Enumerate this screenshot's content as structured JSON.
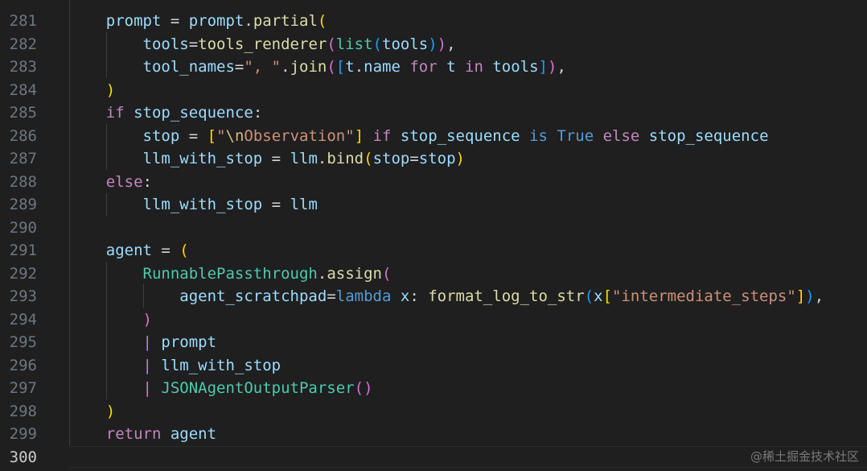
{
  "editor": {
    "current_line": 300,
    "lines": [
      {
        "no": "281",
        "tokens": [
          [
            "    ",
            "op"
          ],
          [
            "prompt",
            "var"
          ],
          [
            " = ",
            "op"
          ],
          [
            "prompt",
            "var"
          ],
          [
            ".",
            "op"
          ],
          [
            "partial",
            "fn"
          ],
          [
            "(",
            "p1"
          ]
        ]
      },
      {
        "no": "282",
        "tokens": [
          [
            "        ",
            "op"
          ],
          [
            "tools",
            "var"
          ],
          [
            "=",
            "op"
          ],
          [
            "tools_renderer",
            "fn"
          ],
          [
            "(",
            "p2"
          ],
          [
            "list",
            "cls"
          ],
          [
            "(",
            "p3"
          ],
          [
            "tools",
            "var"
          ],
          [
            ")",
            "p3"
          ],
          [
            ")",
            "p2"
          ],
          [
            ",",
            "op"
          ]
        ]
      },
      {
        "no": "283",
        "tokens": [
          [
            "        ",
            "op"
          ],
          [
            "tool_names",
            "var"
          ],
          [
            "=",
            "op"
          ],
          [
            "\", \"",
            "str"
          ],
          [
            ".",
            "op"
          ],
          [
            "join",
            "fn"
          ],
          [
            "(",
            "p2"
          ],
          [
            "[",
            "p3"
          ],
          [
            "t",
            "var"
          ],
          [
            ".",
            "op"
          ],
          [
            "name",
            "var"
          ],
          [
            " for ",
            "kw"
          ],
          [
            "t",
            "var"
          ],
          [
            " in ",
            "kw"
          ],
          [
            "tools",
            "var"
          ],
          [
            "]",
            "p3"
          ],
          [
            ")",
            "p2"
          ],
          [
            ",",
            "op"
          ]
        ]
      },
      {
        "no": "284",
        "tokens": [
          [
            "    ",
            "op"
          ],
          [
            ")",
            "p1"
          ]
        ]
      },
      {
        "no": "285",
        "tokens": [
          [
            "    ",
            "op"
          ],
          [
            "if",
            "kw"
          ],
          [
            " ",
            "op"
          ],
          [
            "stop_sequence",
            "var"
          ],
          [
            ":",
            "op"
          ]
        ]
      },
      {
        "no": "286",
        "tokens": [
          [
            "        ",
            "op"
          ],
          [
            "stop",
            "var"
          ],
          [
            " = ",
            "op"
          ],
          [
            "[",
            "p1"
          ],
          [
            "\"",
            "str"
          ],
          [
            "\\n",
            "esc"
          ],
          [
            "Observation\"",
            "str"
          ],
          [
            "]",
            "p1"
          ],
          [
            " if ",
            "kw"
          ],
          [
            "stop_sequence",
            "var"
          ],
          [
            " is ",
            "kw2"
          ],
          [
            "True",
            "kw2"
          ],
          [
            " else ",
            "kw"
          ],
          [
            "stop_sequence",
            "var"
          ]
        ]
      },
      {
        "no": "287",
        "tokens": [
          [
            "        ",
            "op"
          ],
          [
            "llm_with_stop",
            "var"
          ],
          [
            " = ",
            "op"
          ],
          [
            "llm",
            "var"
          ],
          [
            ".",
            "op"
          ],
          [
            "bind",
            "fn"
          ],
          [
            "(",
            "p1"
          ],
          [
            "stop",
            "var"
          ],
          [
            "=",
            "op"
          ],
          [
            "stop",
            "var"
          ],
          [
            ")",
            "p1"
          ]
        ]
      },
      {
        "no": "288",
        "tokens": [
          [
            "    ",
            "op"
          ],
          [
            "else",
            "kw"
          ],
          [
            ":",
            "op"
          ]
        ]
      },
      {
        "no": "289",
        "tokens": [
          [
            "        ",
            "op"
          ],
          [
            "llm_with_stop",
            "var"
          ],
          [
            " = ",
            "op"
          ],
          [
            "llm",
            "var"
          ]
        ]
      },
      {
        "no": "290",
        "tokens": []
      },
      {
        "no": "291",
        "tokens": [
          [
            "    ",
            "op"
          ],
          [
            "agent",
            "var"
          ],
          [
            " = ",
            "op"
          ],
          [
            "(",
            "p1"
          ]
        ]
      },
      {
        "no": "292",
        "tokens": [
          [
            "        ",
            "op"
          ],
          [
            "RunnablePassthrough",
            "cls"
          ],
          [
            ".",
            "op"
          ],
          [
            "assign",
            "fn"
          ],
          [
            "(",
            "p2"
          ]
        ]
      },
      {
        "no": "293",
        "tokens": [
          [
            "            ",
            "op"
          ],
          [
            "agent_scratchpad",
            "var"
          ],
          [
            "=",
            "op"
          ],
          [
            "lambda",
            "kw2"
          ],
          [
            " ",
            "op"
          ],
          [
            "x",
            "var"
          ],
          [
            ": ",
            "op"
          ],
          [
            "format_log_to_str",
            "fn"
          ],
          [
            "(",
            "p3"
          ],
          [
            "x",
            "var"
          ],
          [
            "[",
            "p1"
          ],
          [
            "\"intermediate_steps\"",
            "str"
          ],
          [
            "]",
            "p1"
          ],
          [
            ")",
            "p3"
          ],
          [
            ",",
            "op"
          ]
        ]
      },
      {
        "no": "294",
        "tokens": [
          [
            "        ",
            "op"
          ],
          [
            ")",
            "p2"
          ]
        ]
      },
      {
        "no": "295",
        "tokens": [
          [
            "        ",
            "op"
          ],
          [
            "| ",
            "p2"
          ],
          [
            "prompt",
            "var"
          ]
        ]
      },
      {
        "no": "296",
        "tokens": [
          [
            "        ",
            "op"
          ],
          [
            "| ",
            "p2"
          ],
          [
            "llm_with_stop",
            "var"
          ]
        ]
      },
      {
        "no": "297",
        "tokens": [
          [
            "        ",
            "op"
          ],
          [
            "| ",
            "p2"
          ],
          [
            "JSONAgentOutputParser",
            "cls"
          ],
          [
            "()",
            "p2"
          ]
        ]
      },
      {
        "no": "298",
        "tokens": [
          [
            "    ",
            "op"
          ],
          [
            ")",
            "p1"
          ]
        ]
      },
      {
        "no": "299",
        "tokens": [
          [
            "    ",
            "op"
          ],
          [
            "return",
            "kw"
          ],
          [
            " ",
            "op"
          ],
          [
            "agent",
            "var"
          ]
        ]
      },
      {
        "no": "300",
        "tokens": []
      }
    ]
  },
  "watermark": "@稀土掘金技术社区"
}
